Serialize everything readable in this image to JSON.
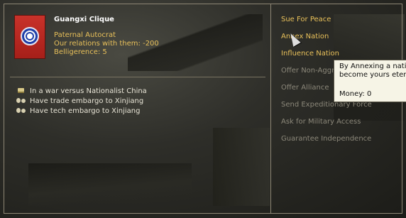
{
  "country": {
    "name": "Guangxi Clique",
    "flag_icon": "kmt-flag-icon"
  },
  "info": {
    "government": "Paternal Autocrat",
    "relations": "Our relations with them: -200",
    "belligerence": "Belligerence: 5"
  },
  "status": [
    {
      "icon": "war-icon",
      "text": "In a war versus Nationalist China"
    },
    {
      "icon": "trade-embargo-icon",
      "text": "Have trade embargo to Xinjiang"
    },
    {
      "icon": "tech-embargo-icon",
      "text": "Have tech embargo to Xinjiang"
    }
  ],
  "actions": [
    {
      "label": "Sue For Peace",
      "enabled": true
    },
    {
      "label": "Annex Nation",
      "enabled": true
    },
    {
      "label": "Influence Nation",
      "enabled": true
    },
    {
      "label": "Offer Non-Aggr",
      "enabled": false
    },
    {
      "label": "Offer Alliance",
      "enabled": false
    },
    {
      "label": "Send Expeditionary Force",
      "enabled": false
    },
    {
      "label": "Ask for Military Access",
      "enabled": false
    },
    {
      "label": "Guarantee Independence",
      "enabled": false
    }
  ],
  "tooltip": {
    "line1": "By Annexing a natio",
    "line2": "become yours etern",
    "money": "Money: 0"
  },
  "colors": {
    "accent_yellow": "#e8c05a",
    "disabled_gray": "#8c887a",
    "frame": "#8e8775"
  }
}
